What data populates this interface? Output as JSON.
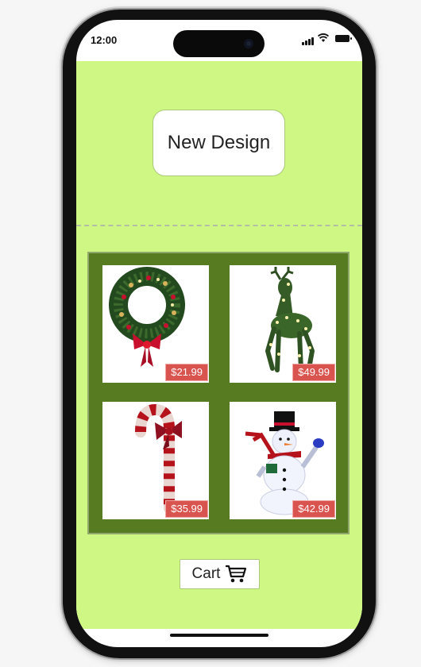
{
  "status_bar": {
    "time": "12:00"
  },
  "header": {
    "title": "New Design"
  },
  "products": [
    {
      "name": "wreath",
      "icon": "wreath-image",
      "price": "$21.99"
    },
    {
      "name": "reindeer",
      "icon": "reindeer-image",
      "price": "$49.99"
    },
    {
      "name": "candy-cane",
      "icon": "candy-cane-image",
      "price": "$35.99"
    },
    {
      "name": "snowman",
      "icon": "snowman-image",
      "price": "$42.99"
    }
  ],
  "cart": {
    "label": "Cart",
    "icon": "cart-icon"
  },
  "colors": {
    "app_background": "#cff784",
    "grid_background": "#577b21",
    "price_badge": "#d9534f"
  }
}
